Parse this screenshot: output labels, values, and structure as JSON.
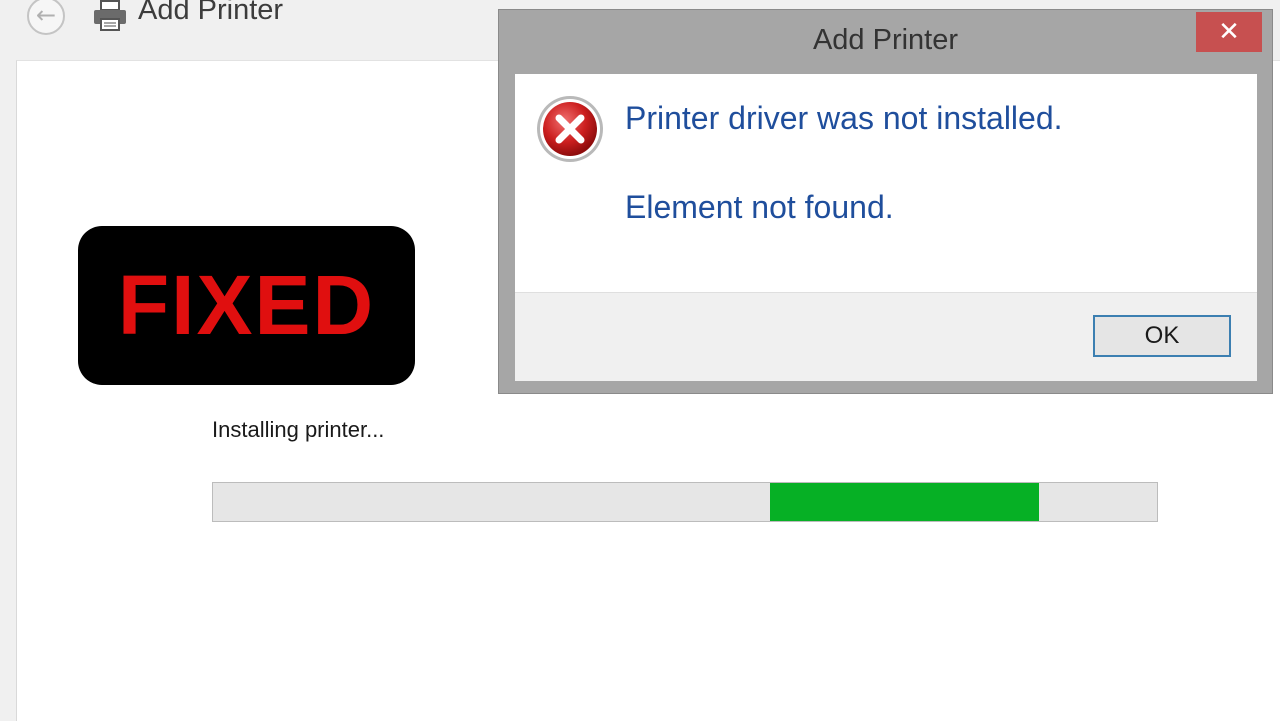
{
  "wizard": {
    "title": "Add Printer",
    "status_text": "Installing printer...",
    "progress": {
      "start_fraction": 0.59,
      "end_fraction": 0.875,
      "color": "#06b025"
    },
    "back_icon": "back-arrow-icon",
    "printer_icon": "printer-icon"
  },
  "badge": {
    "text": "FIXED",
    "text_color": "#e00f0f",
    "background": "#000000"
  },
  "dialog": {
    "title": "Add Printer",
    "close_glyph": "✕",
    "icon": "error-icon",
    "message": "Printer driver was not installed.",
    "detail": "Element not found.",
    "ok_label": "OK",
    "close_color": "#c75050",
    "message_color": "#1f4e9c"
  }
}
